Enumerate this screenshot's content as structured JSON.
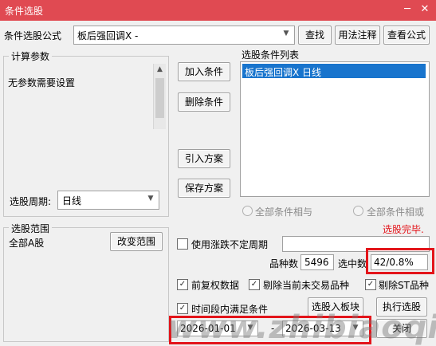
{
  "window": {
    "title": "条件选股"
  },
  "top": {
    "formula_label": "条件选股公式",
    "formula_value": "板后强回调X  -",
    "find_button": "查找",
    "usage_button": "用法注释",
    "view_button": "查看公式"
  },
  "params": {
    "group_title": "计算参数",
    "no_params_text": "无参数需要设置",
    "period_label": "选股周期:",
    "period_value": "日线"
  },
  "actions": {
    "add_condition": "加入条件",
    "delete_condition": "删除条件",
    "import_plan": "引入方案",
    "save_plan": "保存方案"
  },
  "conditions": {
    "list_title": "选股条件列表",
    "items": [
      "板后强回调X  日线"
    ],
    "all_and": "全部条件相与",
    "all_or": "全部条件相或",
    "status": "选股完毕."
  },
  "range": {
    "group_title": "选股范围",
    "value": "全部A股",
    "change_button": "改变范围"
  },
  "options": {
    "uncertain_period_label": "使用涨跌不定周期",
    "uncertain_period_checked": false,
    "stock_count_label": "品种数",
    "stock_count": "5496",
    "selected_label": "选中数",
    "selected_value": "42/0.8%",
    "prior_rights_label": "前复权数据",
    "prior_rights_checked": true,
    "exclude_untraded_label": "剔除当前未交易品种",
    "exclude_untraded_checked": true,
    "exclude_st_label": "剔除ST品种",
    "exclude_st_checked": true,
    "time_range_label": "时间段内满足条件",
    "time_range_checked": true,
    "start_date": "2026-01-01",
    "date_separator": "-",
    "end_date": "2026-03-13"
  },
  "bottom_buttons": {
    "to_block": "选股入板块",
    "execute": "执行选股",
    "close": "关闭"
  },
  "watermark": "www.zhibiaoqi.com",
  "colors": {
    "titlebar": "#e04a52",
    "selection": "#1874cd",
    "highlight_box": "#e3141a",
    "status_text": "#e3141a"
  }
}
